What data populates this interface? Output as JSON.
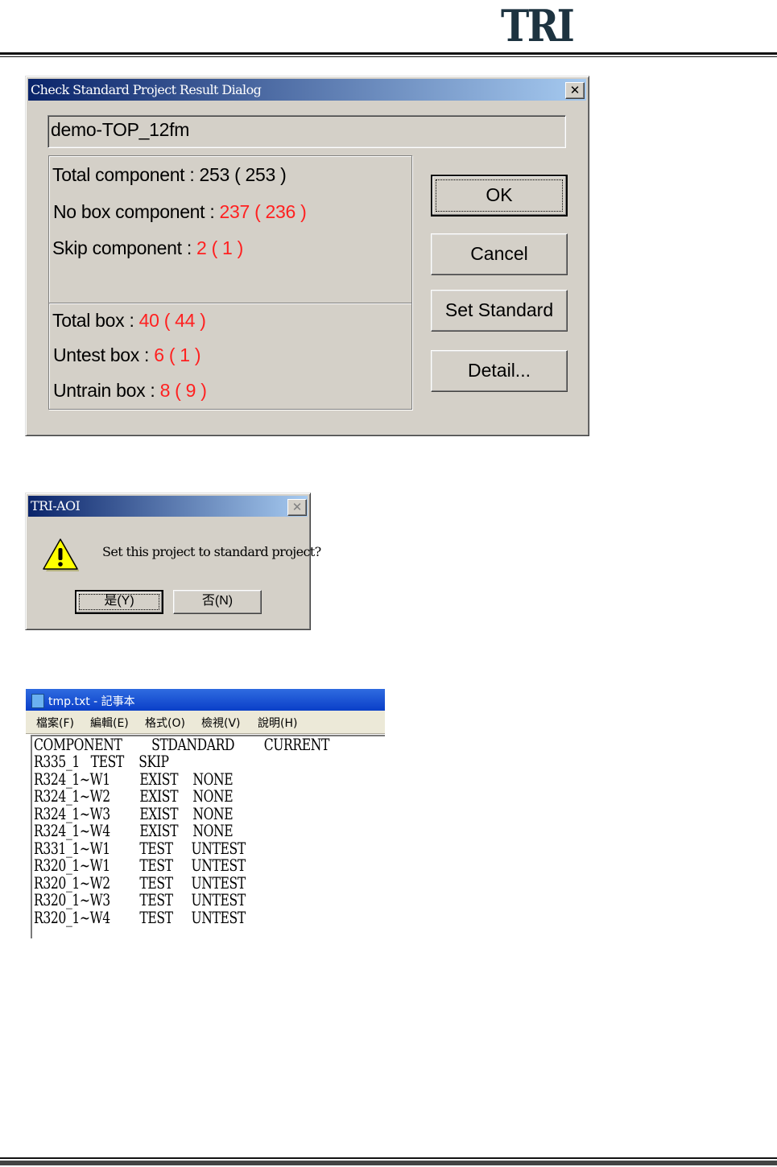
{
  "header": {
    "logo_text": "TRI"
  },
  "check_dialog": {
    "title": "Check Standard Project Result Dialog",
    "close_glyph": "✕",
    "project_name": "demo-TOP_12fm",
    "component_stats": [
      {
        "label": "Total component :",
        "value": "253 ( 253 )",
        "value_color": "#000000"
      },
      {
        "label": "No box component :",
        "value": "237 ( 236 )",
        "value_color": "#ff2020"
      },
      {
        "label": "Skip component :",
        "value": "2 ( 1 )",
        "value_color": "#ff2020"
      }
    ],
    "box_stats": [
      {
        "label": "Total box :",
        "value": "40 ( 44 )",
        "value_color": "#ff2020"
      },
      {
        "label": "Untest box :",
        "value": "6 ( 1 )",
        "value_color": "#ff2020"
      },
      {
        "label": "Untrain box :",
        "value": "8 ( 9 )",
        "value_color": "#ff2020"
      }
    ],
    "buttons": {
      "ok": "OK",
      "cancel": "Cancel",
      "set_standard": "Set Standard",
      "detail": "Detail..."
    }
  },
  "confirm_dialog": {
    "title": "TRI-AOI",
    "close_glyph": "✕",
    "message": "Set this project to standard project?",
    "icon": "warning-icon",
    "buttons": {
      "yes": "是(Y)",
      "no": "否(N)"
    }
  },
  "notepad": {
    "title": "tmp.txt - 記事本",
    "menu": [
      "檔案(F)",
      "編輯(E)",
      "格式(O)",
      "檢視(V)",
      "說明(H)"
    ],
    "lines": [
      "COMPONENT        STDANDARD        CURRENT",
      "R335_1   TEST    SKIP",
      "R324_1~W1        EXIST    NONE",
      "R324_1~W2        EXIST    NONE",
      "R324_1~W3        EXIST    NONE",
      "R324_1~W4        EXIST    NONE",
      "R331_1~W1        TEST     UNTEST",
      "R320_1~W1        TEST     UNTEST",
      "R320_1~W2        TEST     UNTEST",
      "R320_1~W3        TEST     UNTEST",
      "R320_1~W4        TEST     UNTEST"
    ]
  }
}
